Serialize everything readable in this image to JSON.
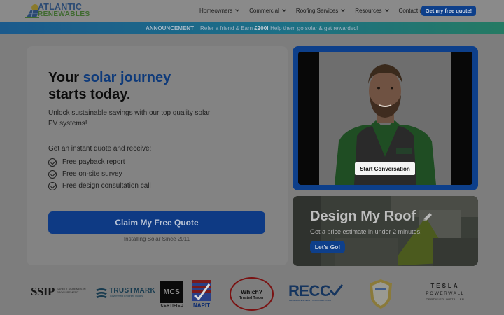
{
  "header": {
    "logo_line1": "ATLANTIC",
    "logo_line2": "RENEWABLES",
    "nav": [
      {
        "label": "Homeowners",
        "dropdown": true
      },
      {
        "label": "Commercial",
        "dropdown": true
      },
      {
        "label": "Roofing Services",
        "dropdown": true
      },
      {
        "label": "Resources",
        "dropdown": true
      },
      {
        "label": "Contact us",
        "dropdown": false
      }
    ],
    "cta_label": "Get my free quote!"
  },
  "announcement": {
    "tag": "ANNOUNCEMENT",
    "text_before": "Refer a friend & Earn",
    "amount": "£200!",
    "text_after": "Help them go solar & get rewarded!"
  },
  "hero": {
    "title_line1_prefix": "Your",
    "title_accent": "solar journey",
    "title_line2": "starts today.",
    "subtitle": "Unlock sustainable savings with our top quality solar PV systems!",
    "intro": "Get an instant quote and receive:",
    "benefits": [
      "Free payback report",
      "Free on-site survey",
      "Free design consultation call"
    ],
    "cta_label": "Claim My Free Quote",
    "since": "Installing Solar Since 2011"
  },
  "video": {
    "button_label": "Start Conversation"
  },
  "roof": {
    "title": "Design My Roof",
    "subtitle_before": "Get a price estimate in",
    "subtitle_link": "under 2 minutes!",
    "button_label": "Let's Go!"
  },
  "badges": {
    "ssip": {
      "big": "SSIP",
      "small": "SAFETY SCHEMES IN PROCUREMENT"
    },
    "trustmark": {
      "word": "TRUSTMARK",
      "tiny": "Government Endorsed Quality"
    },
    "mcs": {
      "box": "MCS",
      "label": "CERTIFIED"
    },
    "napit": {
      "label": "NAPIT"
    },
    "which": {
      "line1": "Which?",
      "line2": "Trusted Trader"
    },
    "recc": {
      "word": "RECC",
      "tiny": "RENEWABLE ENERGY CONSUMER CODE"
    },
    "tesla": {
      "line1": "TESLA",
      "line2": "POWERWALL",
      "line3": "CERTIFIED INSTALLER"
    }
  },
  "colors": {
    "brand_blue": "#0d3f8a",
    "accent_blue": "#0e3a7a",
    "overlay_bg": "#7d7d7d"
  }
}
